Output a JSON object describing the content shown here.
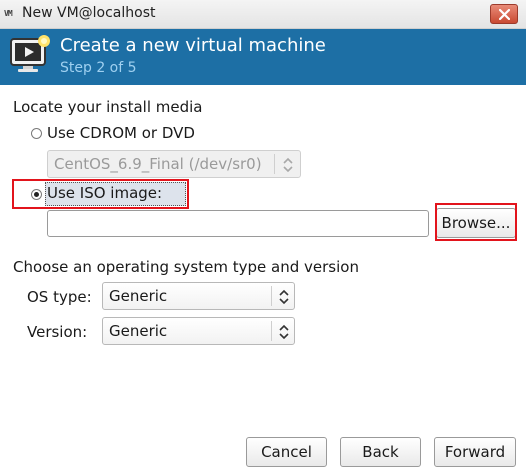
{
  "window": {
    "app_icon_text": "VM",
    "title": "New VM@localhost"
  },
  "header": {
    "title": "Create a new virtual machine",
    "step": "Step 2 of 5"
  },
  "install_media": {
    "section_label": "Locate your install media",
    "cdrom_label": "Use CDROM or DVD",
    "cdrom_selected": false,
    "cdrom_device": "CentOS_6.9_Final (/dev/sr0)",
    "iso_label": "Use ISO image:",
    "iso_selected": true,
    "iso_path": "",
    "browse_label": "Browse..."
  },
  "os": {
    "section_label": "Choose an operating system type and version",
    "type_label": "OS type:",
    "type_value": "Generic",
    "version_label": "Version:",
    "version_value": "Generic"
  },
  "footer": {
    "cancel_label": "Cancel",
    "back_label": "Back",
    "forward_label": "Forward"
  },
  "colors": {
    "banner": "#1d6fa5",
    "step_text": "#9fd0f0",
    "annotation": "#e2141c"
  },
  "icons": {
    "app": "vm-icon",
    "close": "close-icon",
    "header": "monitor-play-icon"
  }
}
